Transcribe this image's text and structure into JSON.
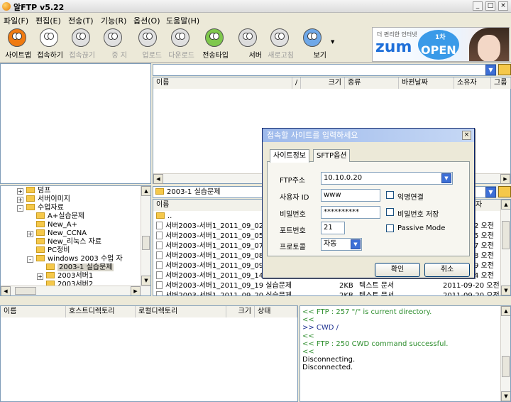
{
  "window": {
    "title": "알FTP  v5.22",
    "min": "_",
    "max": "□",
    "close": "×"
  },
  "menu": [
    "파일(F)",
    "편집(E)",
    "전송(T)",
    "기능(R)",
    "옵션(O)",
    "도움말(H)"
  ],
  "toolbar": [
    {
      "label": "사이트맵",
      "enabled": true,
      "color": "#f07a10"
    },
    {
      "label": "접속하기",
      "enabled": true,
      "color": "#ffffff"
    },
    {
      "label": "접속끊기",
      "enabled": false,
      "color": "#e0e0e0"
    },
    {
      "label": "중 지",
      "enabled": false,
      "color": "#e0e0e0"
    },
    {
      "label": "업로드",
      "enabled": false,
      "color": "#e0e0e0"
    },
    {
      "label": "다운로드",
      "enabled": false,
      "color": "#e0e0e0"
    },
    {
      "label": "전송타입",
      "enabled": true,
      "color": "#7fc84c"
    },
    {
      "label": "서버",
      "enabled": true,
      "color": "#dcdcdc"
    },
    {
      "label": "새로고침",
      "enabled": false,
      "color": "#e0e0e0"
    },
    {
      "label": "보기",
      "enabled": true,
      "color": "#6fa8e8"
    }
  ],
  "ad": {
    "tagline": "더 편리한 인터넷",
    "brand": "zum",
    "badge": "1차",
    "open": "OPEN"
  },
  "remote_top": {
    "path": "",
    "columns": [
      "이름",
      "/",
      "크기",
      "종류",
      "바뀐날짜",
      "소유자",
      "그룹"
    ]
  },
  "local_tree": [
    {
      "label": "덤프",
      "level": 1,
      "expand": "+"
    },
    {
      "label": "서버이미지",
      "level": 1,
      "expand": "+"
    },
    {
      "label": "수업자료",
      "level": 1,
      "expand": "-"
    },
    {
      "label": "A+실습문제",
      "level": 2,
      "expand": ""
    },
    {
      "label": "New_A+",
      "level": 2,
      "expand": ""
    },
    {
      "label": "New_CCNA",
      "level": 2,
      "expand": "+"
    },
    {
      "label": "New_리눅스 자료",
      "level": 2,
      "expand": ""
    },
    {
      "label": "PC정비",
      "level": 2,
      "expand": ""
    },
    {
      "label": "windows 2003 수업 자",
      "level": 2,
      "expand": "-"
    },
    {
      "label": "2003-1 실습문제",
      "level": 3,
      "expand": "",
      "selected": true
    },
    {
      "label": "2003서버1",
      "level": 3,
      "expand": "+"
    },
    {
      "label": "2003서버2",
      "level": 3,
      "expand": ""
    }
  ],
  "local_files": {
    "path": "2003-1 실습문제",
    "header_name": "이름",
    "header_right": "자",
    "rows": [
      {
        "name": "..",
        "size": "",
        "type": "",
        "date": ""
      },
      {
        "name": "서버2003-서버1_2011_09_02 실",
        "size": "",
        "type": "",
        "date": "2 오전"
      },
      {
        "name": "서버2003-서버1_2011_09_05 실",
        "size": "",
        "type": "",
        "date": "5 오전"
      },
      {
        "name": "서버2003-서버1_2011_09_07 실",
        "size": "",
        "type": "",
        "date": "7 오전"
      },
      {
        "name": "서버2003-서버1_2011_09_08 실",
        "size": "",
        "type": "",
        "date": "8 오전"
      },
      {
        "name": "서버2003-서버1_2011_09_09 실",
        "size": "",
        "type": "",
        "date": "9 오전"
      },
      {
        "name": "서버2003-서버1_2011_09_14 실",
        "size": "",
        "type": "",
        "date": "4 오전"
      },
      {
        "name": "서버2003-서버1_2011_09_19 실습문제",
        "size": "2KB",
        "type": "텍스트 문서",
        "date": "2011-09-20 오전"
      },
      {
        "name": "서버2003-서버1_2011_09_20 실습문제",
        "size": "2KB",
        "type": "텍스트 문서",
        "date": "2011-09-20 오전"
      }
    ]
  },
  "queue": {
    "columns": [
      "이름",
      "호스트디렉토리",
      "로컬디렉토리",
      "크기",
      "상태"
    ]
  },
  "log": [
    {
      "text": "<< FTP : 257 \"/\" is current directory.",
      "color": "#2f8f2f"
    },
    {
      "text": "<<",
      "color": "#2f8f2f"
    },
    {
      "text": ">> CWD /",
      "color": "#1a2e8f"
    },
    {
      "text": "<<",
      "color": "#2f8f2f"
    },
    {
      "text": "<< FTP : 250 CWD command successful.",
      "color": "#2f8f2f"
    },
    {
      "text": "<<",
      "color": "#2f8f2f"
    },
    {
      "text": "Disconnecting.",
      "color": "#000000"
    },
    {
      "text": "Disconnected.",
      "color": "#000000"
    }
  ],
  "dialog": {
    "title": "접속할 사이트를 입력하세요",
    "tabs": [
      "사이트정보",
      "SFTP옵션"
    ],
    "ftp_address_label": "FTP주소",
    "ftp_address": "10.10.0.20",
    "user_id_label": "사용자 ID",
    "user_id": "www",
    "anonymous_label": "익명연결",
    "password_label": "비밀번호",
    "password": "**********",
    "save_password_label": "비밀번호 저장",
    "port_label": "포트번호",
    "port": "21",
    "passive_label": "Passive Mode",
    "protocol_label": "프로토콜",
    "protocol": "자동",
    "ok": "확인",
    "cancel": "취소"
  }
}
